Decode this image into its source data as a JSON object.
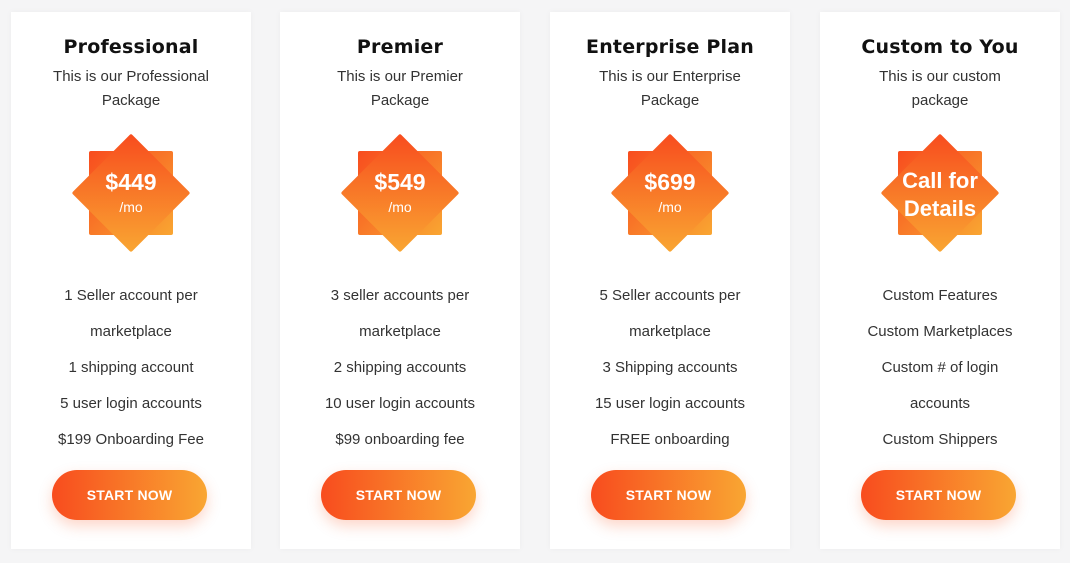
{
  "colors": {
    "accent_start": "#f84c1e",
    "accent_end": "#f9a632",
    "card_bg": "#ffffff"
  },
  "plans": [
    {
      "title": "Professional",
      "description": "This is our Professional Package",
      "price": "$449",
      "period": "/mo",
      "features": [
        "1 Seller account per",
        "marketplace",
        "1 shipping account",
        "5 user login accounts",
        "$199 Onboarding Fee"
      ],
      "button": "START NOW"
    },
    {
      "title": "Premier",
      "description": "This is our Premier Package",
      "price": "$549",
      "period": "/mo",
      "features": [
        "3 seller accounts per",
        "marketplace",
        "2 shipping accounts",
        "10 user login accounts",
        "$99 onboarding fee"
      ],
      "button": "START NOW"
    },
    {
      "title": "Enterprise Plan",
      "description": "This is our Enterprise Package",
      "price": "$699",
      "period": "/mo",
      "features": [
        "5 Seller accounts per",
        "marketplace",
        "3 Shipping accounts",
        "15 user login accounts",
        "FREE onboarding"
      ],
      "button": "START NOW"
    },
    {
      "title": "Custom to You",
      "description": "This is our custom package",
      "badge_line1": "Call for",
      "badge_line2": "Details",
      "features": [
        "Custom Features",
        "Custom Marketplaces",
        "Custom # of login",
        "accounts",
        "Custom Shippers"
      ],
      "button": "START NOW"
    }
  ]
}
